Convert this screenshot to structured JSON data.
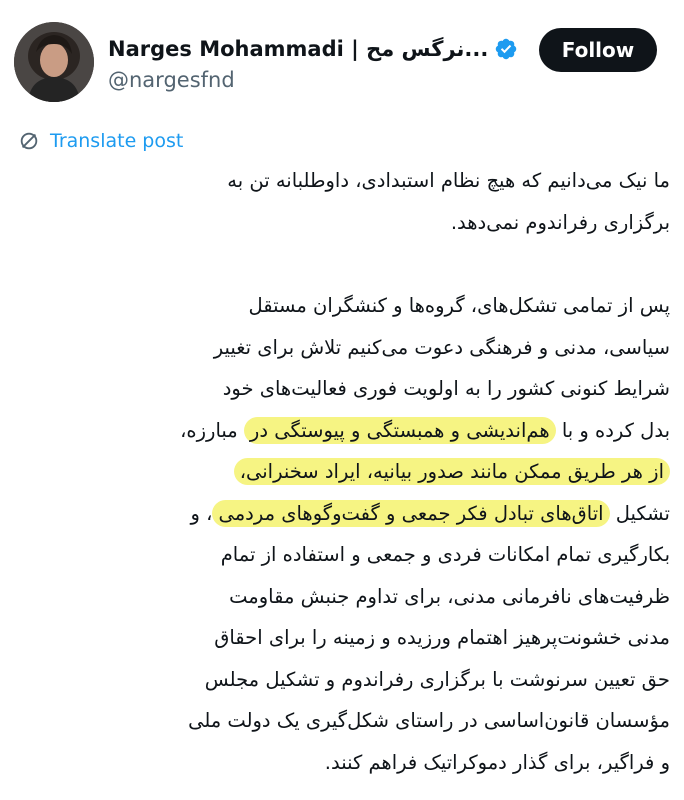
{
  "author": {
    "display_name": "Narges Mohammadi | نرگس مح...",
    "handle": "@nargesfnd",
    "verified": true,
    "verified_color": "#1d9bf0"
  },
  "follow_button": {
    "label": "Follow",
    "background": "#0f1419",
    "text_color": "#ffffff"
  },
  "translate": {
    "label": "Translate post",
    "icon": "translate-icon",
    "color": "#1d9bf0"
  },
  "highlight_color": "#f6f483",
  "post": {
    "p1": [
      "ما نیک می‌دانیم که هیچ نظام استبدادی، داوطلبانه تن به",
      "برگزاری رفراندوم نمی‌دهد."
    ],
    "p2": [
      "پس از تمامی تشکل‌های، گروه‌ها و کنشگران مستقل",
      "سیاسی، مدنی و فرهنگی دعوت می‌کنیم تلاش برای تغییر",
      "شرایط کنونی کشور را به اولویت فوری فعالیت‌های خود"
    ],
    "l6_plain": "بدل کرده و با ",
    "l6_hl": "هم‌اندیشی و همبستگی و پیوستگی در",
    "l6_end": " مبارزه،",
    "l7_hl": "از هر طریق ممکن مانند صدور بیانیه، ایراد سخنرانی،",
    "l8_plain": "تشکیل ",
    "l8_hl": "اتاق‌های تبادل فکر جمعی و گفت‌وگوهای مردمی",
    "l8_end": "، و",
    "p2_rest": [
      "بکارگیری تمام امکانات فردی و جمعی و استفاده از تمام",
      "ظرفیت‌های نافرمانی مدنی، برای تداوم جنبش مقاومت",
      "مدنی خشونت‌پرهیز اهتمام ورزیده و زمینه را برای احقاق",
      "حق تعیین سرنوشت با برگزاری رفراندوم و تشکیل مجلس",
      "مؤسسان قانون‌اساسی در راستای شکل‌گیری یک دولت ملی",
      "و فراگیر، برای گذار دموکراتیک فراهم کنند."
    ]
  }
}
